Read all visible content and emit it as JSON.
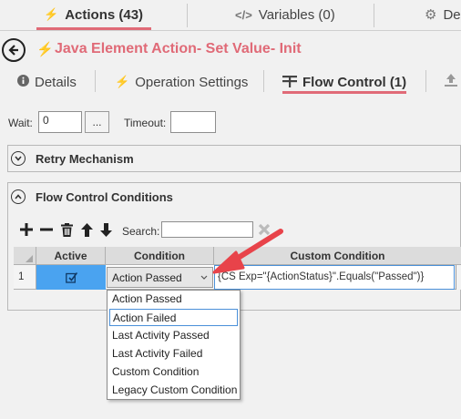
{
  "top_tabs": [
    {
      "label": "Actions (43)",
      "icon": "bolt-icon",
      "active": true
    },
    {
      "label": "Variables (0)",
      "icon": "code-icon",
      "active": false
    },
    {
      "label": "De",
      "icon": "gear-icon",
      "active": false
    }
  ],
  "header": {
    "title": "Java Element Action- Set Value- Init"
  },
  "sub_tabs": [
    {
      "label": "Details",
      "icon": "info-icon",
      "active": false
    },
    {
      "label": "Operation Settings",
      "icon": "bolt-icon",
      "active": false
    },
    {
      "label": "Flow Control (1)",
      "icon": "flow-control-icon",
      "active": true
    }
  ],
  "wait": {
    "label": "Wait:",
    "value": "0",
    "dots": "...",
    "timeout_label": "Timeout:",
    "timeout_value": ""
  },
  "retry": {
    "title": "Retry Mechanism"
  },
  "flow": {
    "title": "Flow Control Conditions"
  },
  "toolbar": {
    "search_label": "Search:",
    "search_value": ""
  },
  "grid": {
    "columns": [
      "Active",
      "Condition",
      "Custom Condition"
    ],
    "rows": [
      {
        "num": "1",
        "condition": "Action Passed",
        "custom": "{CS Exp=\"{ActionStatus}\".Equals(\"Passed\")}"
      }
    ]
  },
  "dropdown_options": [
    "Action Passed",
    "Action Failed",
    "Last Activity Passed",
    "Last Activity Failed",
    "Custom Condition",
    "Legacy Custom Condition"
  ],
  "colors": {
    "accent": "#e06a77",
    "selection": "#4aa3f0",
    "arrow": "#e8434a"
  }
}
